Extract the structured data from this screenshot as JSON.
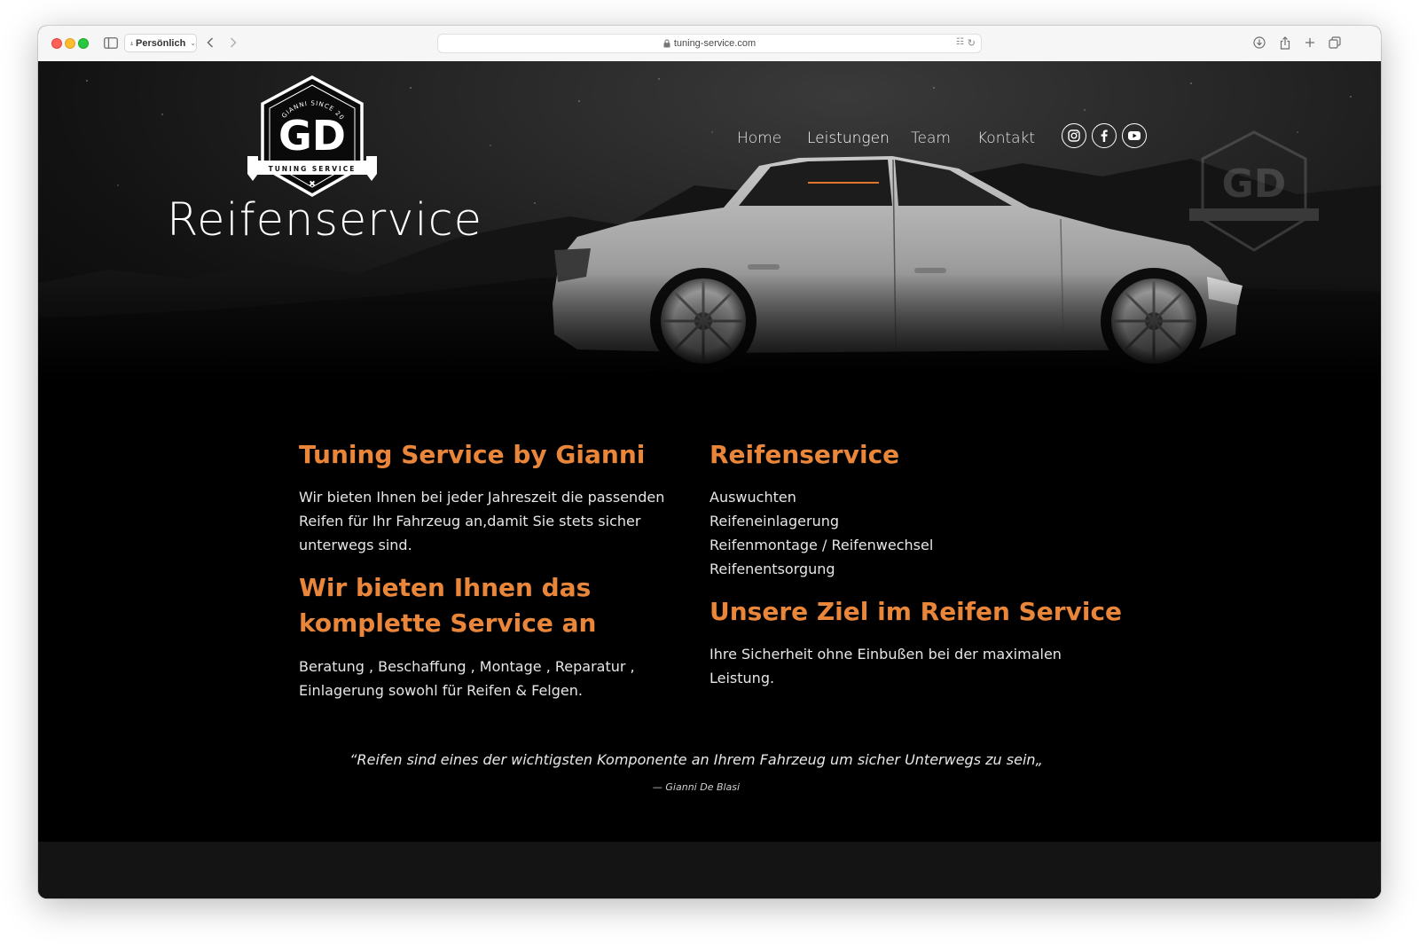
{
  "browser": {
    "profile_label": "Persönlich",
    "url": "tuning-service.com"
  },
  "site": {
    "logo": {
      "top_text": "BY GIANNI SINCE 2003",
      "monogram": "GD",
      "ribbon_text": "TUNING SERVICE"
    },
    "hero_title": "Reifenservice",
    "nav": [
      {
        "label": "Home",
        "active": false
      },
      {
        "label": "Leistungen",
        "active": true
      },
      {
        "label": "Team",
        "active": false
      },
      {
        "label": "Kontakt",
        "active": false
      }
    ],
    "social": [
      "instagram-icon",
      "facebook-icon",
      "youtube-icon"
    ],
    "accent_color": "#e9863a"
  },
  "content": {
    "left": {
      "heading1": "Tuning Service by Gianni",
      "para1_lines": [
        "Wir bieten Ihnen bei jeder Jahreszeit die passenden",
        "Reifen für Ihr Fahrzeug an,damit Sie stets sicher",
        "unterwegs sind."
      ],
      "heading2_lines": [
        "Wir bieten Ihnen das",
        "komplette Service an"
      ],
      "para2_lines": [
        "Beratung , Beschaffung , Montage , Reparatur ,",
        "Einlagerung sowohl für Reifen & Felgen."
      ]
    },
    "right": {
      "heading1": "Reifenservice",
      "services": [
        "Auswuchten",
        "Reifeneinlagerung",
        "Reifenmontage / Reifenwechsel",
        "Reifenentsorgung"
      ],
      "heading2": "Unsere Ziel im Reifen Service",
      "para_lines": [
        "Ihre Sicherheit ohne Einbußen bei der maximalen",
        "Leistung."
      ]
    },
    "quote": "“Reifen sind eines der wichtigsten Komponente an Ihrem Fahrzeug um sicher Unterwegs zu sein„",
    "quote_author": "— Gianni De Blasi"
  }
}
